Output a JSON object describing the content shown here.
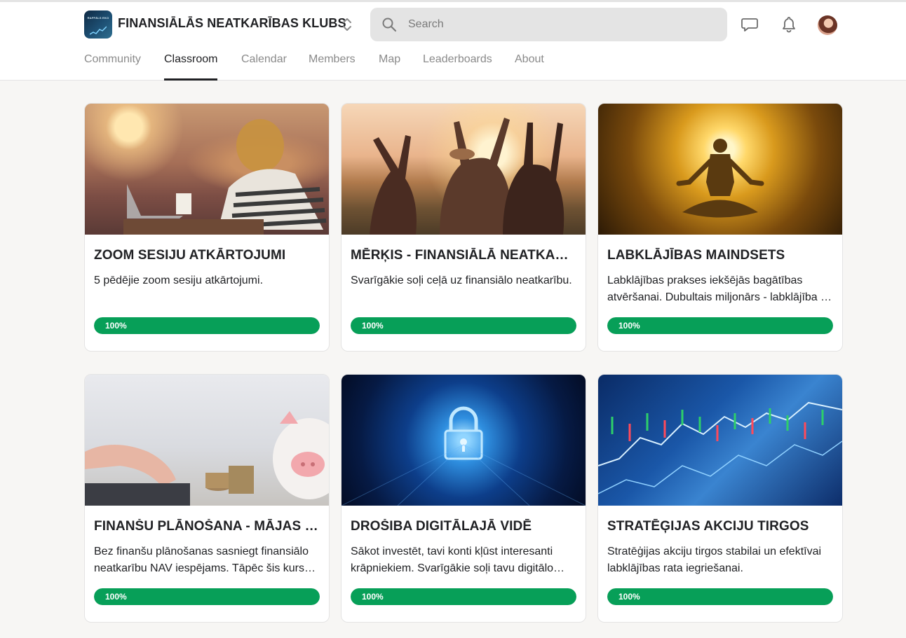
{
  "header": {
    "group_title": "FINANSIĀLĀS NEATKARĪBAS KLUBS",
    "logo_text": "RAFFĀLS EKO",
    "search_placeholder": "Search",
    "icons": [
      "group-switch-icon",
      "search-icon",
      "chat-icon",
      "bell-icon"
    ]
  },
  "nav": {
    "tabs": [
      {
        "label": "Community",
        "active": false
      },
      {
        "label": "Classroom",
        "active": true
      },
      {
        "label": "Calendar",
        "active": false
      },
      {
        "label": "Members",
        "active": false
      },
      {
        "label": "Map",
        "active": false
      },
      {
        "label": "Leaderboards",
        "active": false
      },
      {
        "label": "About",
        "active": false
      }
    ]
  },
  "courses": [
    {
      "title": "ZOOM SESIJU ATKĀRTOJUMI",
      "description": "5 pēdējie zoom sesiju atkārtojumi.",
      "progress": 100,
      "progress_label": "100%",
      "image": "woman-studying-cafe"
    },
    {
      "title": "MĒRĶIS - FINANSIĀLĀ NEATKARĪBA",
      "description": "Svarīgākie soļi ceļā uz finansiālo neatkarību.",
      "progress": 100,
      "progress_label": "100%",
      "image": "friends-sunset-field"
    },
    {
      "title": "LABKLĀJĪBAS MAINDSETS",
      "description": "Labklājības prakses iekšējās bagātības atvēršanai. Dubultais miljonārs - labklājība un prieks ikvienā dzīves jomā.",
      "progress": 100,
      "progress_label": "100%",
      "image": "golden-meditation"
    },
    {
      "title": "FINANŠU PLĀNOŠANA - MĀJAS BUDŽETS",
      "description": "Bez finanšu plānošanas sasniegt finansiālo neatkarību NAV iespējams. Tāpēc šis kurss ir pamats visam.",
      "progress": 100,
      "progress_label": "100%",
      "image": "piggy-bank-coins"
    },
    {
      "title": "DROŠIBA DIGITĀLAJĀ VIDĒ",
      "description": "Sākot investēt, tavi konti kļūst interesanti krāpniekiem. Svarīgākie soļi tavu digitālo kontu aizsardzībai.",
      "progress": 100,
      "progress_label": "100%",
      "image": "digital-padlock"
    },
    {
      "title": "STRATĒĢIJAS AKCIJU TIRGOS",
      "description": "Stratēģijas akciju tirgos stabilai un efektīvai labklājības rata iegriešanai.",
      "progress": 100,
      "progress_label": "100%",
      "image": "stock-chart"
    }
  ],
  "colors": {
    "progress": "#079f58",
    "background": "#f7f6f4",
    "search_bg": "#e4e4e4",
    "text": "#202124",
    "muted": "#8a8a8a"
  }
}
